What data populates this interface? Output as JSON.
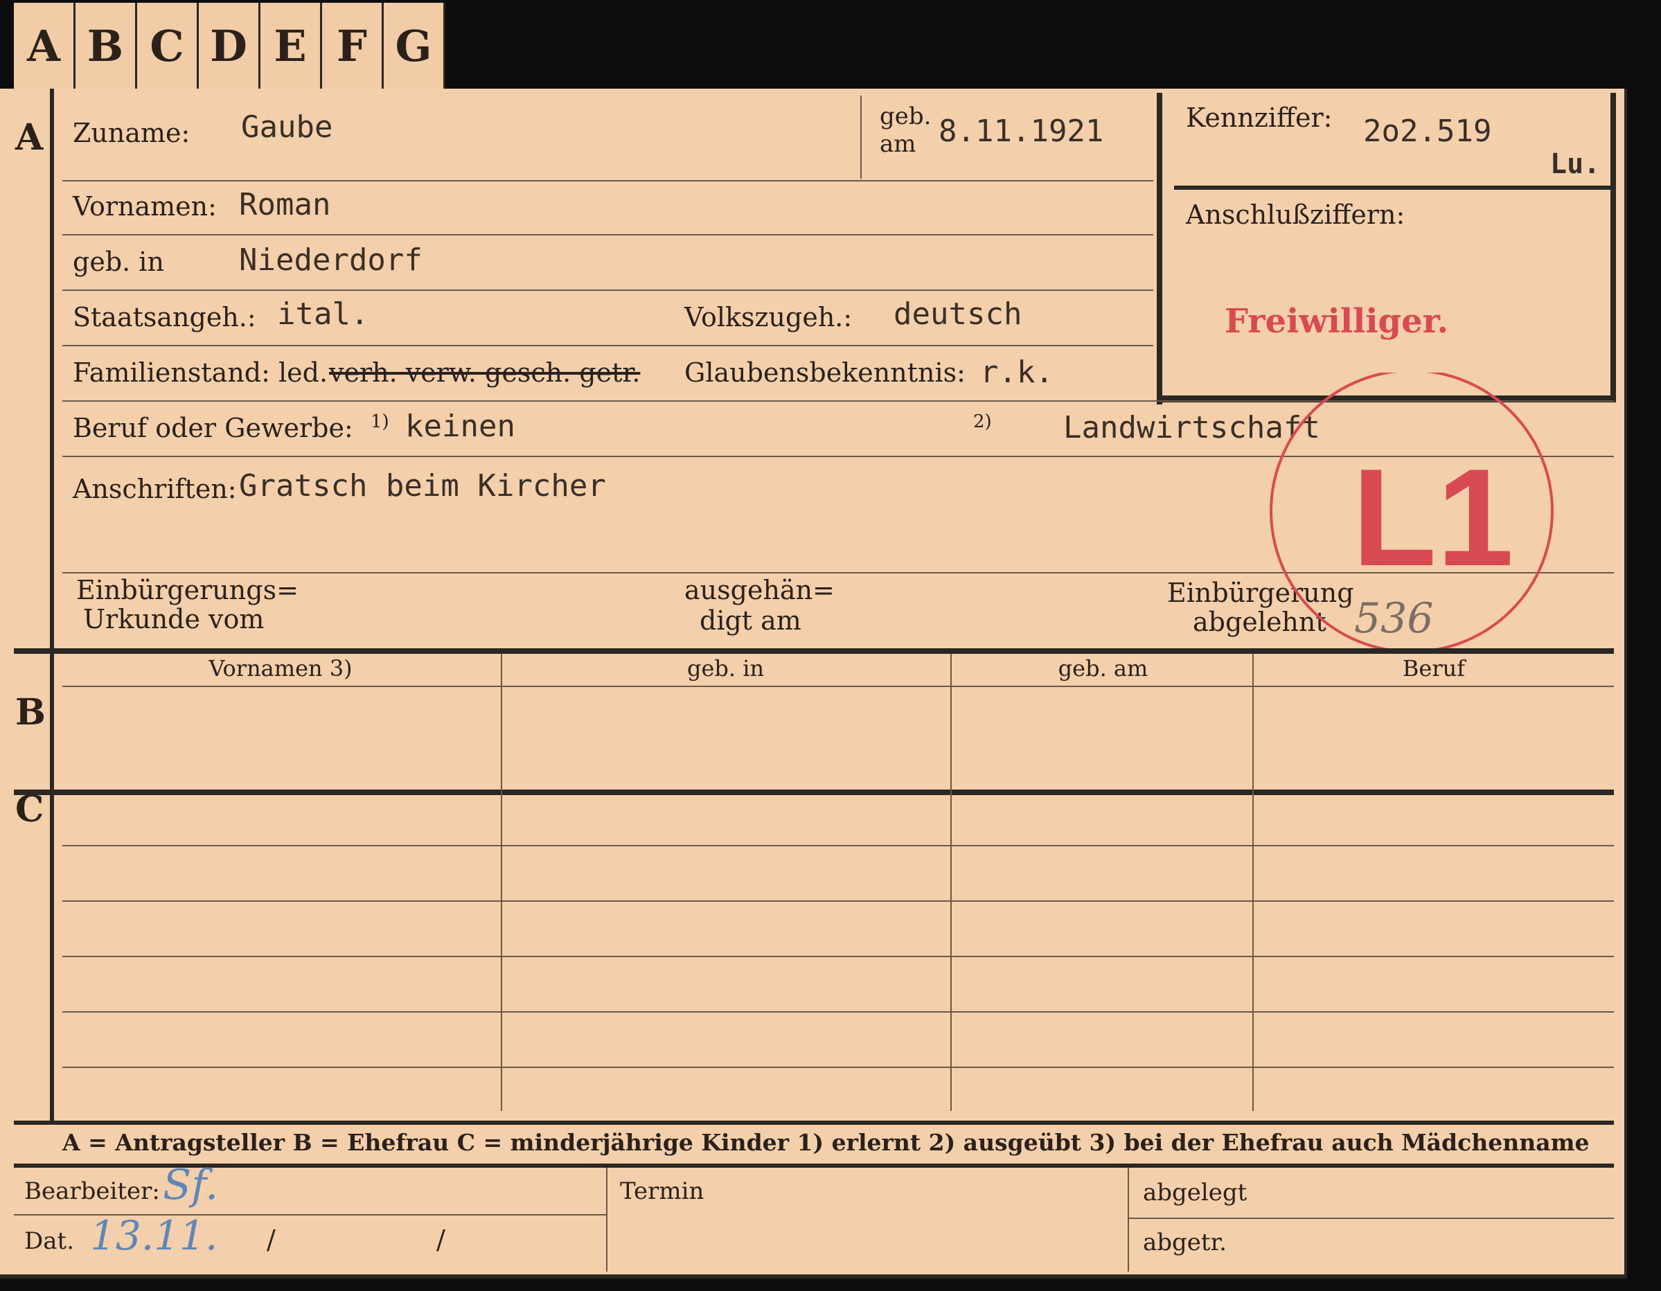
{
  "tabs": [
    "A",
    "B",
    "C",
    "D",
    "E",
    "F",
    "G"
  ],
  "sections": {
    "a": "A",
    "b": "B",
    "c": "C"
  },
  "person": {
    "surname_label": "Zuname:",
    "surname": "Gaube",
    "birthdate_label_1": "geb.",
    "birthdate_label_2": "am",
    "birthdate": "8.11.1921",
    "firstname_label": "Vornamen:",
    "firstname": "Roman",
    "birthplace_label": "geb. in",
    "birthplace": "Niederdorf",
    "citizenship_label": "Staatsangeh.:",
    "citizenship": "ital.",
    "ethnicity_label": "Volkszugeh.:",
    "ethnicity": "deutsch",
    "marital_label": "Familienstand: led.",
    "marital_struck": "verh. verw. gesch. getr.",
    "religion_label": "Glaubensbekenntnis:",
    "religion": "r.k.",
    "profession_label": "Beruf oder Gewerbe:",
    "profession_1_mark": "1)",
    "profession_1": "keinen",
    "profession_2_mark": "2)",
    "profession_2": "Landwirtschaft",
    "address_label": "Anschriften:",
    "address": "Gratsch beim Kircher",
    "naturalization_doc_1": "Einbürgerungs=",
    "naturalization_doc_2": "Urkunde vom",
    "handed_1": "ausgehän=",
    "handed_2": "digt am",
    "naturalization_refused_1": "Einbürgerung",
    "naturalization_refused_2": "abgelehnt"
  },
  "id_box": {
    "label": "Kennziffer:",
    "value": "2o2.519",
    "suffix": "Lu.",
    "connect_label": "Anschlußziffern:",
    "volunteer": "Freiwilliger."
  },
  "stamp": {
    "code": "L1",
    "number": "536",
    "color": "#d84a52"
  },
  "table_headers": [
    "Vornamen 3)",
    "geb. in",
    "geb. am",
    "Beruf"
  ],
  "legend": "A = Antragsteller   B = Ehefrau   C = minderjährige Kinder   1) erlernt   2) ausgeübt   3) bei der Ehefrau auch Mädchenname",
  "footer": {
    "editor_label": "Bearbeiter:",
    "editor_sig": "Sf.",
    "date_label": "Dat.",
    "date_value": "13.11.",
    "slash1": "/",
    "slash2": "/",
    "termin_label": "Termin",
    "filed_label": "abgelegt",
    "abgetr_label": "abgetr."
  }
}
